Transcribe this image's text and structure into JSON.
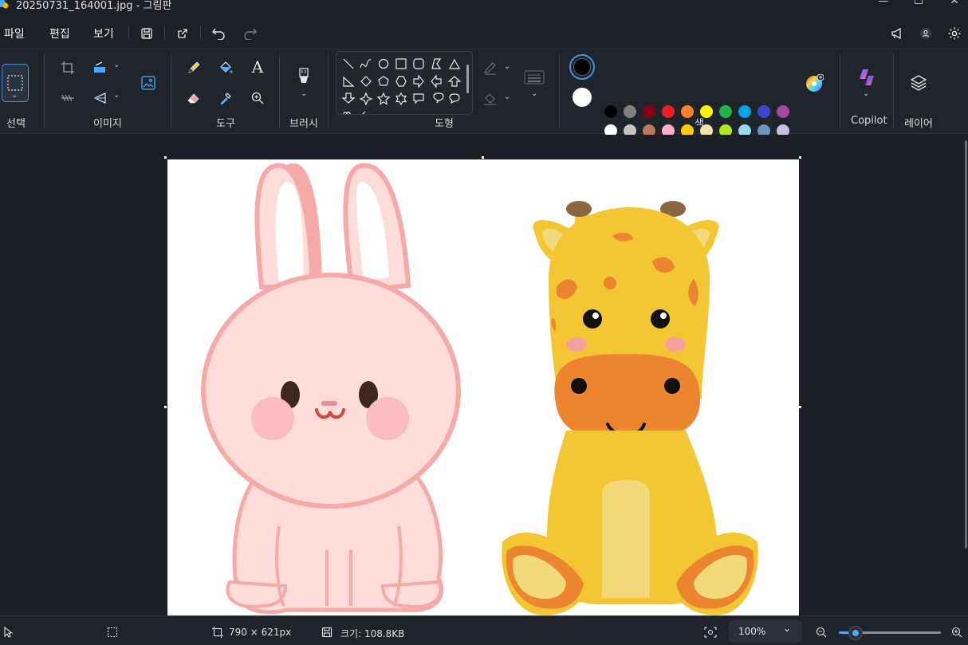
{
  "window": {
    "title": "20250731_164001.jpg - 그림판",
    "controls": [
      "minimize-icon",
      "maximize-icon",
      "close-icon"
    ]
  },
  "menu": {
    "items": [
      "파일",
      "편집",
      "보기"
    ]
  },
  "ribbon": {
    "groups": {
      "select": "선택",
      "image": "이미지",
      "tools": "도구",
      "brushes": "브러시",
      "shapes": "도형",
      "colors": "색",
      "copilot": "Copilot",
      "layers": "레이어"
    },
    "primary_color": "#000000",
    "secondary_color": "#ffffff",
    "palette_row1": [
      "#000000",
      "#7f7f7f",
      "#880015",
      "#ed1c24",
      "#ff7f27",
      "#fff200",
      "#22b14c",
      "#00a2e8",
      "#3f48cc",
      "#a349a4"
    ],
    "palette_row2": [
      "#ffffff",
      "#c3c3c3",
      "#b97a57",
      "#ffaec9",
      "#ffc90e",
      "#efe4b0",
      "#b5e61d",
      "#99d9ea",
      "#7092be",
      "#c8bfe7"
    ],
    "palette_row3_empty": 10
  },
  "status": {
    "canvas_size": "790 × 621px",
    "file_size": "크기: 108.8KB",
    "zoom": "100%",
    "zoom_level": 1.0
  }
}
